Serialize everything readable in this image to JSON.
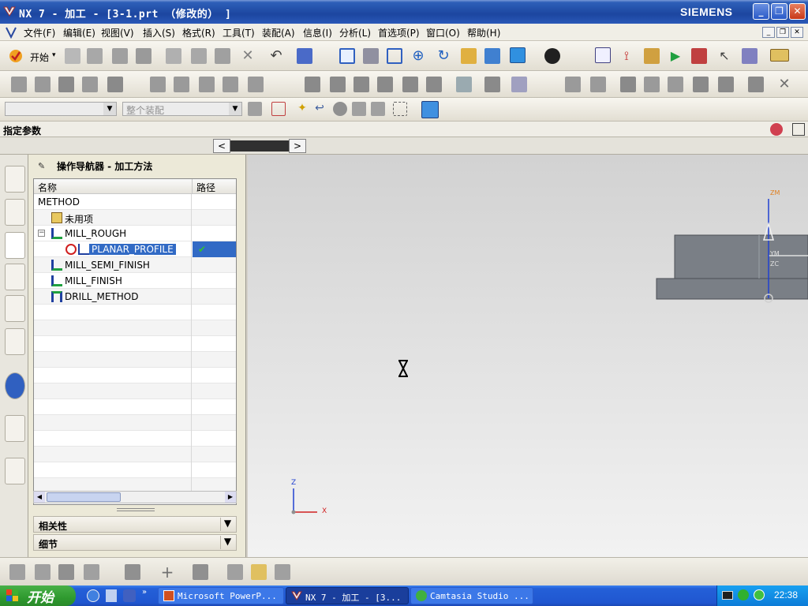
{
  "window": {
    "title": "NX 7 - 加工 - [3-1.prt （修改的） ]",
    "brand": "SIEMENS",
    "buttons": {
      "minimize": "_",
      "restore": "❐",
      "close": "✕"
    }
  },
  "menubar": {
    "items": [
      "文件(F)",
      "编辑(E)",
      "视图(V)",
      "插入(S)",
      "格式(R)",
      "工具(T)",
      "装配(A)",
      "信息(I)",
      "分析(L)",
      "首选项(P)",
      "窗口(O)",
      "帮助(H)"
    ]
  },
  "toolbar": {
    "start_label": "开始",
    "selection_filter": "",
    "assembly_scope": "整个装配"
  },
  "params_bar": {
    "label": "指定参数"
  },
  "navigator": {
    "title": "操作导航器 - 加工方法",
    "columns": [
      "名称",
      "路径"
    ],
    "rows": [
      {
        "name": "METHOD",
        "path": ""
      },
      {
        "name": "未用项",
        "path": ""
      },
      {
        "name": "MILL_ROUGH",
        "path": ""
      },
      {
        "name": "PLANAR_PROFILE",
        "path": "✔",
        "selected": true
      },
      {
        "name": "MILL_SEMI_FINISH",
        "path": ""
      },
      {
        "name": "MILL_FINISH",
        "path": ""
      },
      {
        "name": "DRILL_METHOD",
        "path": ""
      }
    ],
    "sections": [
      "相关性",
      "细节"
    ]
  },
  "graphics": {
    "triad": {
      "z": "Z",
      "x": "X"
    },
    "model_labels": {
      "ym": "YM",
      "zc": "ZC",
      "top": "ZM"
    },
    "colors": {
      "background_top": "#d2d2d2",
      "background_bottom": "#f2f2f2",
      "model": "#7a7f86"
    }
  },
  "taskbar": {
    "start": "开始",
    "tasks": [
      {
        "label": "Microsoft PowerP..."
      },
      {
        "label": "NX 7 - 加工 - [3..."
      },
      {
        "label": "Camtasia Studio ..."
      }
    ],
    "clock": "22:38"
  }
}
